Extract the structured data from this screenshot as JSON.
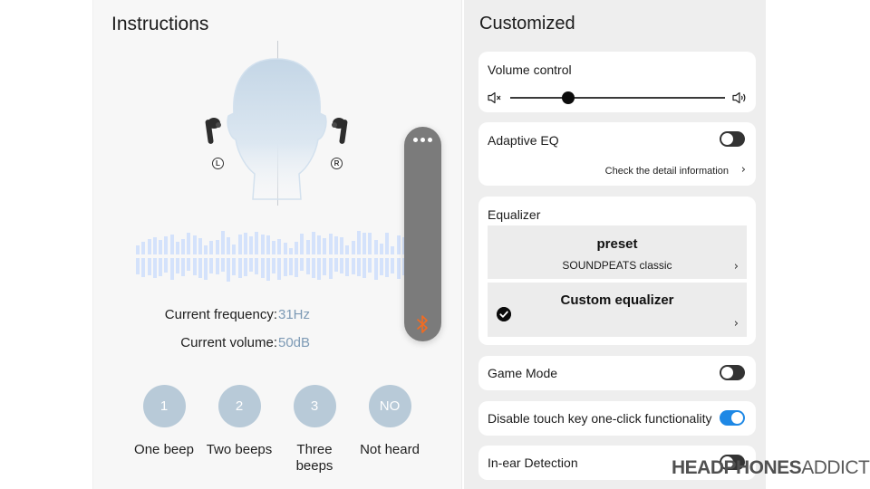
{
  "instructions": {
    "title": "Instructions",
    "ear_labels": {
      "left": "L",
      "right": "R"
    },
    "waveform_top": [
      10,
      14,
      17,
      19,
      16,
      20,
      22,
      14,
      17,
      24,
      21,
      18,
      10,
      15,
      16,
      26,
      19,
      11,
      22,
      24,
      20,
      25,
      22,
      21,
      15,
      17,
      13,
      7,
      14,
      23,
      16,
      25,
      21,
      18,
      23,
      20,
      19,
      10,
      15,
      26,
      24,
      24,
      16,
      12,
      24,
      9,
      21,
      19
    ],
    "waveform_bottom": [
      18,
      21,
      19,
      22,
      20,
      16,
      24,
      17,
      20,
      14,
      19,
      22,
      24,
      17,
      18,
      15,
      26,
      19,
      22,
      20,
      15,
      18,
      22,
      25,
      17,
      24,
      20,
      19,
      21,
      14,
      18,
      22,
      24,
      19,
      23,
      15,
      17,
      20,
      18,
      20,
      22,
      16,
      24,
      19,
      21,
      17,
      23,
      19
    ],
    "current_frequency_label": "Current frequency:",
    "current_frequency_value": "31Hz",
    "current_volume_label": "Current volume:",
    "current_volume_value": "50dB",
    "answers": [
      {
        "symbol": "1",
        "label": "One beep"
      },
      {
        "symbol": "2",
        "label": "Two beeps"
      },
      {
        "symbol": "3",
        "label": "Three beeps"
      },
      {
        "symbol": "NO",
        "label": "Not heard"
      }
    ]
  },
  "floating_control": {
    "menu_icon": "more-dots-icon",
    "bluetooth_icon": "bluetooth-icon",
    "bluetooth_color": "#f26b21"
  },
  "customized": {
    "title": "Customized",
    "volume_control": {
      "label": "Volume control",
      "level_fraction": 0.27,
      "mute_icon": "volume-mute-icon",
      "loud_icon": "volume-up-icon"
    },
    "adaptive_eq": {
      "label": "Adaptive EQ",
      "enabled": false,
      "detail_link": "Check the detail information"
    },
    "equalizer": {
      "label": "Equalizer",
      "preset": {
        "title": "preset",
        "value": "SOUNDPEATS classic",
        "selected": false
      },
      "custom": {
        "title": "Custom equalizer",
        "selected": true
      }
    },
    "game_mode": {
      "label": "Game Mode",
      "enabled": false
    },
    "disable_touch_key": {
      "label": "Disable touch key one-click functionality",
      "enabled": true,
      "accent": "#1e88e5"
    },
    "in_ear_detection": {
      "label": "In-ear Detection",
      "enabled": false
    }
  },
  "watermark": {
    "bold": "HEADPHONES",
    "light": "ADDICT"
  }
}
